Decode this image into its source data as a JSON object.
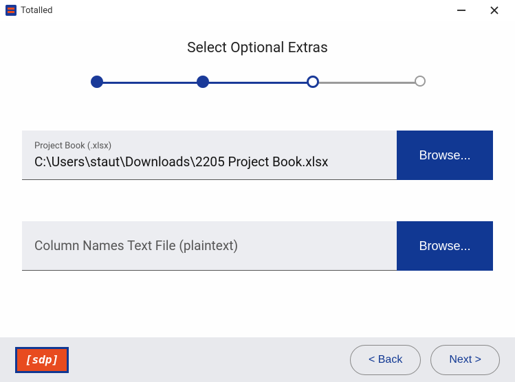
{
  "window": {
    "title": "Totalled"
  },
  "header": {
    "title": "Select Optional Extras"
  },
  "stepper": {
    "total": 4,
    "completed": 2,
    "current": 3
  },
  "fields": {
    "projectBook": {
      "label": "Project Book (.xlsx)",
      "value": "C:\\Users\\staut\\Downloads\\2205 Project Book.xlsx",
      "browse": "Browse..."
    },
    "columnNames": {
      "placeholder": "Column Names Text File (plaintext)",
      "value": "",
      "browse": "Browse..."
    }
  },
  "footer": {
    "logo": "[sdp]",
    "back": "< Back",
    "next": "Next >"
  }
}
